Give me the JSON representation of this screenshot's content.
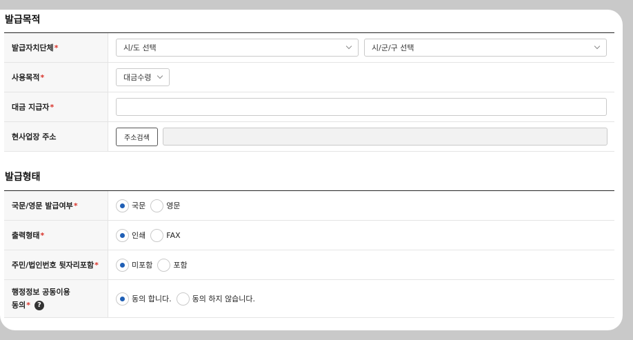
{
  "section1": {
    "title": "발급목적",
    "rows": {
      "issuer": {
        "label": "발급자치단체",
        "sido_placeholder": "시/도 선택",
        "sigungu_placeholder": "시/군/구 선택"
      },
      "purpose": {
        "label": "사용목적",
        "value": "대금수령"
      },
      "payer": {
        "label": "대금 지급자",
        "value": ""
      },
      "address": {
        "label": "현사업장 주소",
        "button": "주소검색",
        "value": ""
      }
    }
  },
  "section2": {
    "title": "발급형태",
    "rows": {
      "language": {
        "label": "국문/영문 발급여부",
        "options": [
          "국문",
          "영문"
        ],
        "selected": "국문"
      },
      "output": {
        "label": "출력형태",
        "options": [
          "인쇄",
          "FAX"
        ],
        "selected": "인쇄"
      },
      "idnum": {
        "label": "주민/법인번호 뒷자리포함",
        "options": [
          "미포함",
          "포함"
        ],
        "selected": "미포함"
      },
      "consent": {
        "label_line1": "행정정보 공동이용",
        "label_line2": "동의",
        "options": [
          "동의 합니다.",
          "동의 하지 않습니다."
        ],
        "selected": "동의 합니다."
      }
    }
  },
  "required_mark": "*",
  "help_icon": "?"
}
